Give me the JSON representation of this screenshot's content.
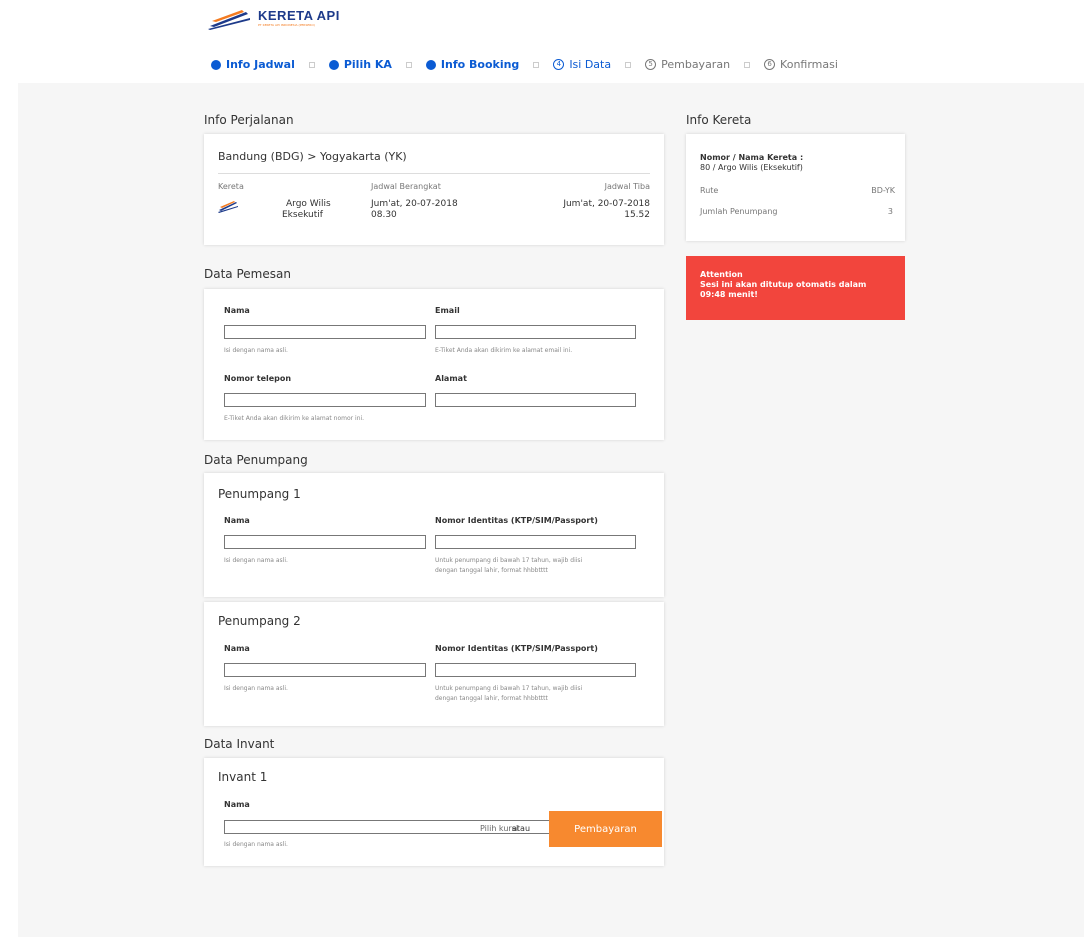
{
  "brand": {
    "name": "KERETA API",
    "sub": "PT KERETA API INDONESIA (PERSERO)"
  },
  "steps": [
    {
      "label": "Info Jadwal"
    },
    {
      "label": "Pilih KA"
    },
    {
      "label": "Info Booking"
    },
    {
      "label": "Isi Data",
      "num": "4"
    },
    {
      "label": "Pembayaran",
      "num": "5"
    },
    {
      "label": "Konfirmasi",
      "num": "6"
    }
  ],
  "trip": {
    "section_title": "Info Perjalanan",
    "route": "Bandung (BDG) > Yogyakarta (YK)",
    "kereta_label": "Kereta",
    "train_name": "Argo Wilis",
    "train_class": "Eksekutif",
    "depart_label": "Jadwal Berangkat",
    "depart_date": "Jum'at, 20-07-2018",
    "depart_time": "08.30",
    "arrive_label": "Jadwal Tiba",
    "arrive_date": "Jum'at, 20-07-2018",
    "arrive_time": "15.52"
  },
  "train_info": {
    "section_title": "Info Kereta",
    "name_label": "Nomor / Nama Kereta :",
    "name_value": "80 / Argo Wilis (Eksekutif)",
    "rute_label": "Rute",
    "rute_value": "BD-YK",
    "pax_label": "Jumlah Penumpang",
    "pax_value": "3"
  },
  "alert": {
    "title": "Attention",
    "message": "Sesi ini akan ditutup otomatis dalam 09:48 menit!"
  },
  "pemesan": {
    "section_title": "Data Pemesan",
    "nama_label": "Nama",
    "nama_hint": "Isi dengan nama asli.",
    "email_label": "Email",
    "email_hint": "E-Tiket Anda akan dikirim ke alamat email ini.",
    "telp_label": "Nomor telepon",
    "telp_hint": "E-Tiket Anda akan dikirim ke alamat nomor ini.",
    "alamat_label": "Alamat"
  },
  "penumpang": {
    "section_title": "Data Penumpang",
    "items": [
      {
        "title": "Penumpang 1",
        "nama_label": "Nama",
        "nama_hint": "Isi dengan nama asli.",
        "id_label": "Nomor Identitas (KTP/SIM/Passport)",
        "id_hint_1": "Untuk penumpang di bawah 17 tahun, wajib diisi",
        "id_hint_2": "dengan tanggal lahir, format hhbbtttt"
      },
      {
        "title": "Penumpang 2",
        "nama_label": "Nama",
        "nama_hint": "Isi dengan nama asli.",
        "id_label": "Nomor Identitas (KTP/SIM/Passport)",
        "id_hint_1": "Untuk penumpang di bawah 17 tahun, wajib diisi",
        "id_hint_2": "dengan tanggal lahir, format hhbbtttt"
      }
    ]
  },
  "invant": {
    "section_title": "Data Invant",
    "title": "Invant 1",
    "nama_label": "Nama",
    "nama_hint": "Isi dengan nama asli."
  },
  "actions": {
    "pilih_kursi": "Pilih kursi",
    "atau": "atau",
    "pay_button": "Pembayaran"
  },
  "colors": {
    "primary": "#0b5bd3",
    "orange": "#f7892f",
    "alert": "#f2453d"
  }
}
